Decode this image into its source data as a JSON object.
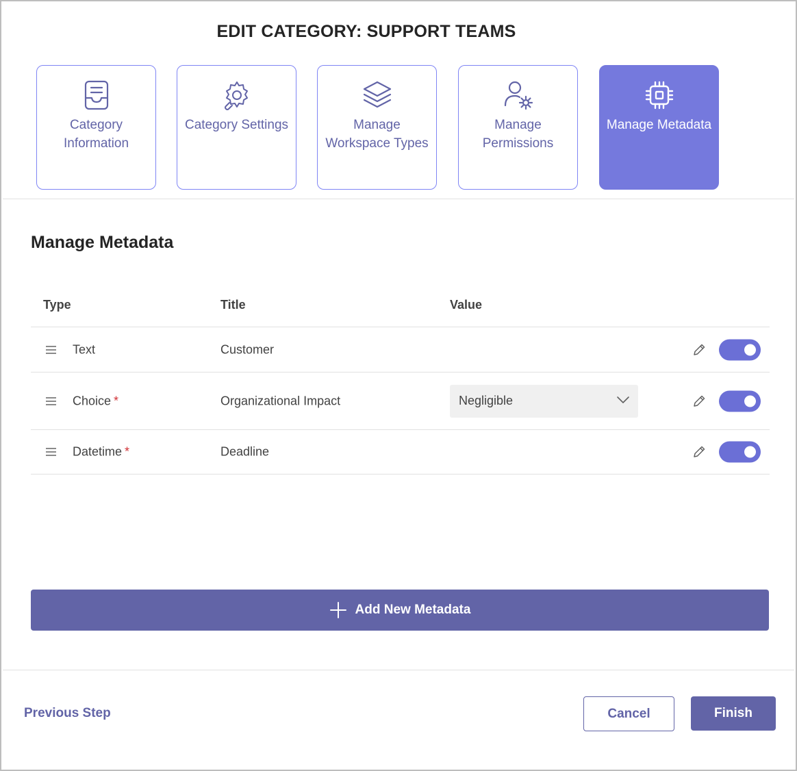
{
  "dialog": {
    "title": "EDIT CATEGORY: SUPPORT TEAMS"
  },
  "steps": [
    {
      "label": "Category Information",
      "icon": "inbox-icon",
      "active": false
    },
    {
      "label": "Category Settings",
      "icon": "wrench-gear-icon",
      "active": false
    },
    {
      "label": "Manage Workspace Types",
      "icon": "layers-icon",
      "active": false
    },
    {
      "label": "Manage Permissions",
      "icon": "person-gear-icon",
      "active": false
    },
    {
      "label": "Manage Metadata",
      "icon": "chip-icon",
      "active": true
    }
  ],
  "section": {
    "title": "Manage Metadata"
  },
  "table": {
    "headers": {
      "type": "Type",
      "title": "Title",
      "value": "Value"
    },
    "rows": [
      {
        "type": "Text",
        "required": false,
        "title": "Customer",
        "value": "",
        "enabled": true
      },
      {
        "type": "Choice",
        "required": true,
        "required_mark": "*",
        "title": "Organizational Impact",
        "value": "Negligible",
        "enabled": true
      },
      {
        "type": "Datetime",
        "required": true,
        "required_mark": "*",
        "title": "Deadline",
        "value": "",
        "enabled": true
      }
    ]
  },
  "actions": {
    "add_label": "Add New Metadata",
    "previous_label": "Previous Step",
    "cancel_label": "Cancel",
    "finish_label": "Finish"
  },
  "colors": {
    "accent": "#6264a7",
    "step_border": "#7f85f5",
    "step_active_bg": "#7579dd",
    "toggle_on": "#6b6fd6",
    "required": "#d13438"
  }
}
